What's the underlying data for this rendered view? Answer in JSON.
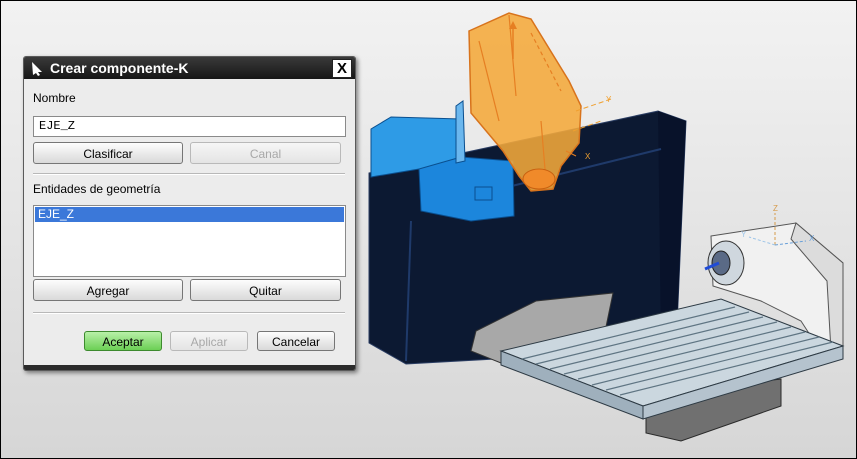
{
  "dialog": {
    "title": "Crear componente-K",
    "close_glyph": "X",
    "name_label": "Nombre",
    "name_value": "EJE_Z",
    "classify_button": "Clasificar",
    "channel_button": "Canal",
    "geometry_label": "Entidades de geometría",
    "geometry_items": [
      "EJE_Z"
    ],
    "add_button": "Agregar",
    "remove_button": "Quitar",
    "accept_button": "Aceptar",
    "apply_button": "Aplicar",
    "cancel_button": "Cancelar"
  },
  "viewport": {
    "axis_labels": {
      "x": "X",
      "y": "Y",
      "z": "Z"
    }
  },
  "colors": {
    "selected_body": "#f0a030",
    "highlight_body": "#1e90ff",
    "machine_body": "#0d1a33",
    "table_body": "#c7d3dc",
    "accept_green": "#6ccf55"
  },
  "icons": {
    "title_icon": "cursor-arrow-icon",
    "close_icon": "close-icon"
  }
}
